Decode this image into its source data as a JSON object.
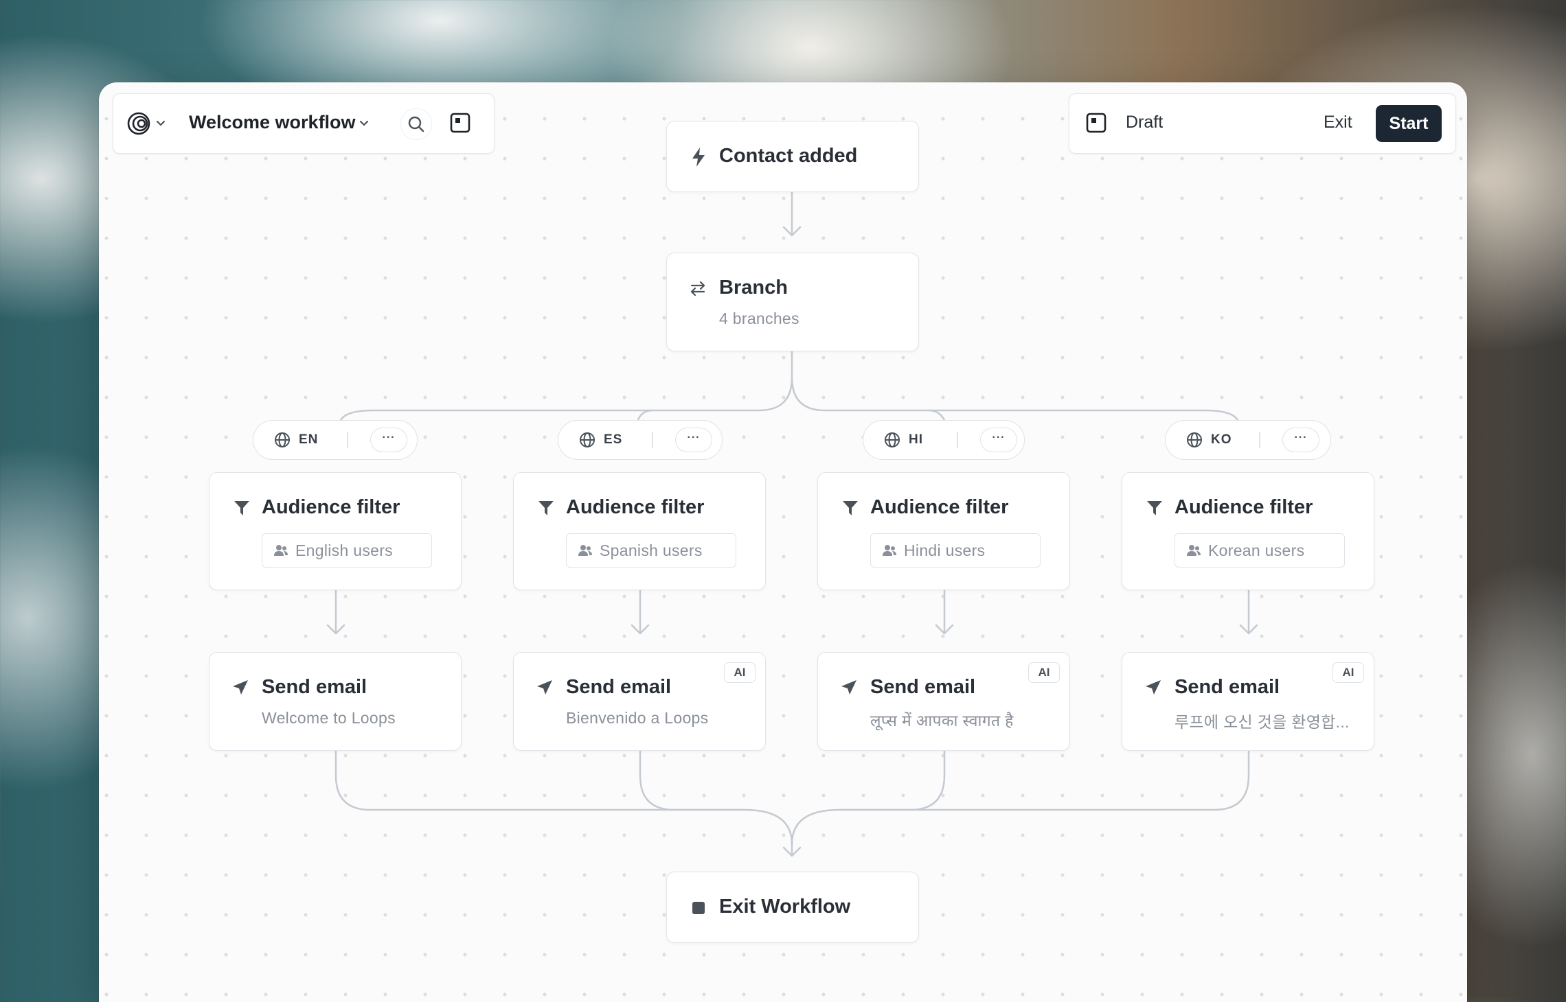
{
  "toolbar": {
    "workflow_name": "Welcome workflow",
    "status": "Draft",
    "exit_label": "Exit",
    "start_label": "Start"
  },
  "nodes": {
    "trigger": {
      "title": "Contact added"
    },
    "branch": {
      "title": "Branch",
      "subtitle": "4 branches"
    },
    "exit": {
      "title": "Exit Workflow"
    }
  },
  "branches": [
    {
      "code": "EN",
      "more": "···",
      "filter_title": "Audience filter",
      "audience": "English users",
      "email_title": "Send email",
      "email_subject": "Welcome to Loops",
      "ai": ""
    },
    {
      "code": "ES",
      "more": "···",
      "filter_title": "Audience filter",
      "audience": "Spanish users",
      "email_title": "Send email",
      "email_subject": "Bienvenido a Loops",
      "ai": "AI"
    },
    {
      "code": "HI",
      "more": "···",
      "filter_title": "Audience filter",
      "audience": "Hindi users",
      "email_title": "Send email",
      "email_subject": "लूप्स में आपका स्वागत है",
      "ai": "AI"
    },
    {
      "code": "KO",
      "more": "···",
      "filter_title": "Audience filter",
      "audience": "Korean users",
      "email_title": "Send email",
      "email_subject": "루프에 오신 것을 환영합...",
      "ai": "AI"
    }
  ],
  "colors": {
    "primary_button": "#1d2733",
    "connector": "#c5cad1",
    "canvas": "#fbfbfb"
  },
  "icons": [
    "loops-logo-icon",
    "chevron-down-icon",
    "search-icon",
    "panel-icon",
    "lightning-icon",
    "branch-arrows-icon",
    "globe-icon",
    "filter-icon",
    "users-icon",
    "send-icon",
    "stop-icon"
  ]
}
